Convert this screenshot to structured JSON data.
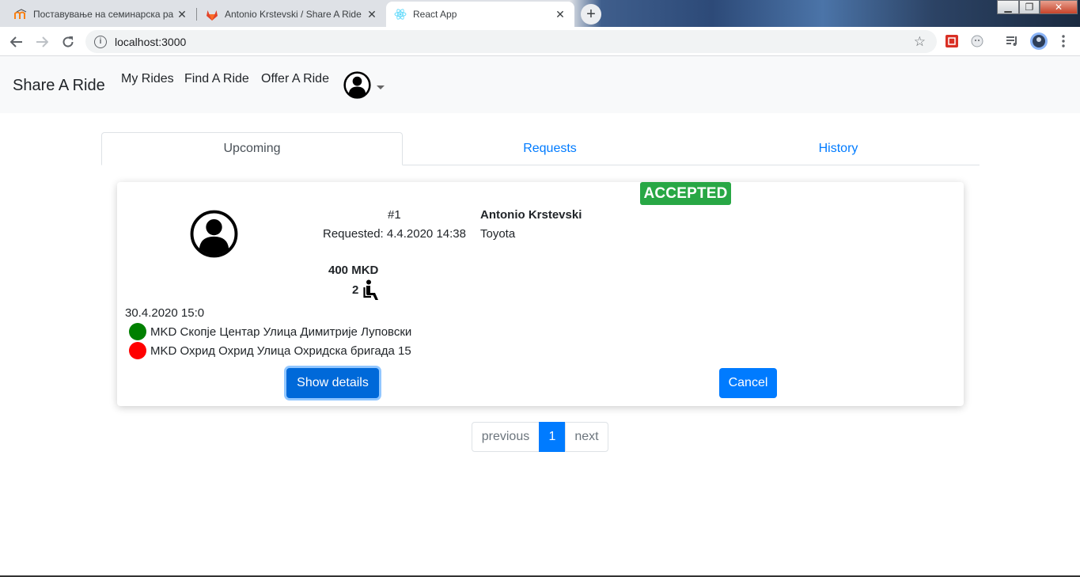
{
  "browser": {
    "tabs": [
      {
        "title": "Поставување на семинарска ра",
        "active": false,
        "favicon": "moodle-icon"
      },
      {
        "title": "Antonio Krstevski / Share A Ride",
        "active": false,
        "favicon": "gitlab-icon"
      },
      {
        "title": "React App",
        "active": true,
        "favicon": "react-icon"
      }
    ],
    "url": "localhost:3000"
  },
  "navbar": {
    "brand": "Share A Ride",
    "links": [
      "My Rides",
      "Find A Ride",
      "Offer A Ride"
    ],
    "user_icon": "user-circle-icon"
  },
  "ride_tabs": [
    {
      "label": "Upcoming",
      "active": true
    },
    {
      "label": "Requests",
      "active": false
    },
    {
      "label": "History",
      "active": false
    }
  ],
  "ride_card": {
    "status": "ACCEPTED",
    "status_color": "#28a745",
    "number": "#1",
    "requested": "Requested: 4.4.2020 14:38",
    "driver_name": "Antonio Krstevski",
    "car": "Toyota",
    "price": "400 MKD",
    "seats": "2",
    "seat_icon": "seated-person-icon",
    "departure_datetime": "30.4.2020 15:0",
    "from": {
      "label": "MKD Скопје Центар Улица Димитрије Луповски",
      "color": "#008000"
    },
    "to": {
      "label": "MKD Охрид Охрид Улица Охридска бригада 15",
      "color": "#ff0000"
    },
    "details_button": "Show details",
    "cancel_button": "Cancel"
  },
  "pagination": {
    "previous": "previous",
    "current": "1",
    "next": "next"
  },
  "colors": {
    "primary": "#007bff",
    "success": "#28a745",
    "navbar_bg": "#f8f9fa"
  }
}
